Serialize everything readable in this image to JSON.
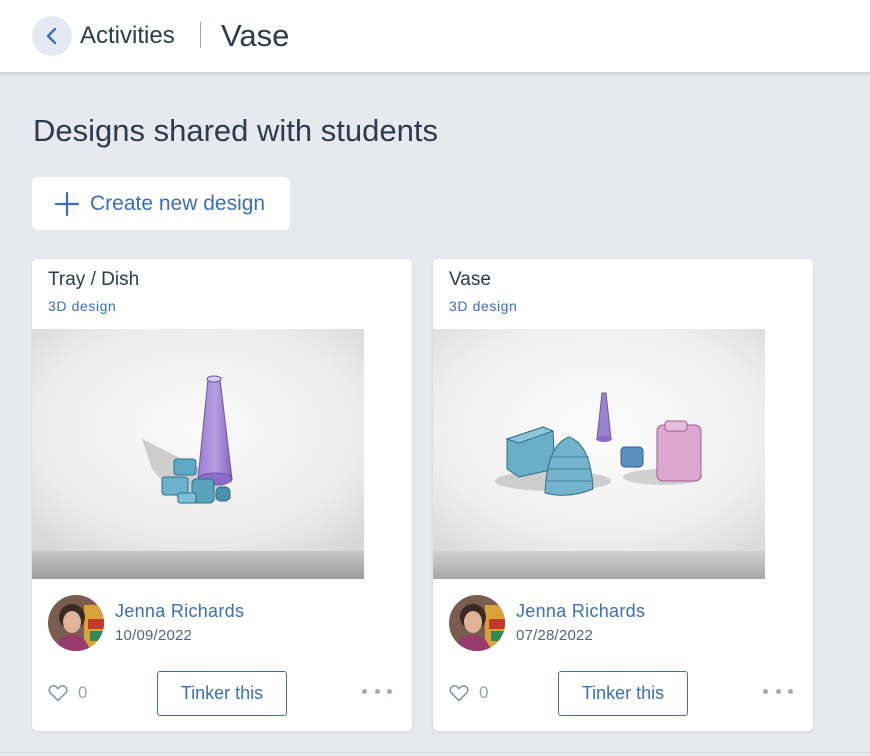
{
  "header": {
    "back_icon": "chevron-left-icon",
    "breadcrumb": "Activities",
    "title": "Vase"
  },
  "main": {
    "section_title": "Designs shared with students",
    "create_button": {
      "label": "Create new design",
      "icon": "plus-icon"
    },
    "cards": [
      {
        "title": "Tray / Dish",
        "type": "3D design",
        "author": "Jenna Richards",
        "date": "10/09/2022",
        "likes": "0",
        "action": "Tinker this"
      },
      {
        "title": "Vase",
        "type": "3D design",
        "author": "Jenna Richards",
        "date": "07/28/2022",
        "likes": "0",
        "action": "Tinker this"
      }
    ]
  },
  "colors": {
    "accent": "#3a6fbf",
    "text": "#2d3b4e",
    "background": "#e8e9ee",
    "muted": "#9aa3b0"
  }
}
